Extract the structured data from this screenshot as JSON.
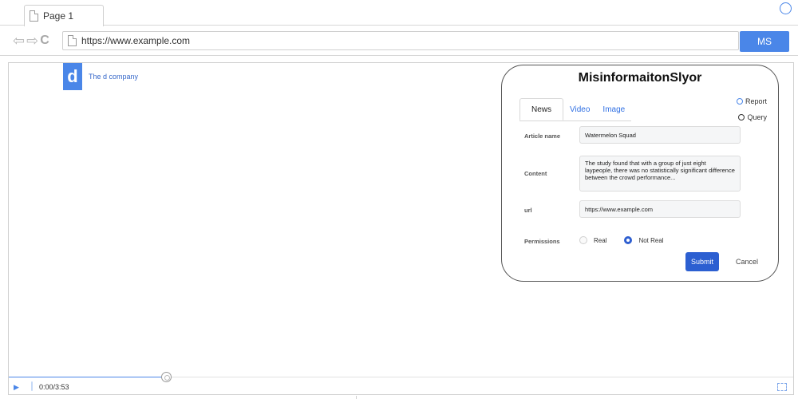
{
  "browser": {
    "tab_title": "Page 1",
    "url": "https://www.example.com",
    "extension_button_label": "MS"
  },
  "site": {
    "logo_letter": "d",
    "company_name": "The d company"
  },
  "popup": {
    "title": "MisinformaitonSlyor",
    "modes": [
      {
        "label": "Report",
        "selected": true
      },
      {
        "label": "Query",
        "selected": false
      }
    ],
    "tabs": [
      {
        "label": "News",
        "active": true
      },
      {
        "label": "Video",
        "active": false
      },
      {
        "label": "Image",
        "active": false
      }
    ],
    "fields": {
      "article_name": {
        "label": "Article name",
        "value": "Watermelon Squad"
      },
      "content": {
        "label": "Content",
        "value": "The study found that with a group of just eight laypeople, there was no statistically significant difference between the crowd performance..."
      },
      "url": {
        "label": "url",
        "value": "https://www.example.com"
      }
    },
    "permissions": {
      "label": "Permissions",
      "options": [
        {
          "label": "Real",
          "selected": false
        },
        {
          "label": "Not Real",
          "selected": true
        }
      ]
    },
    "submit_label": "Submit",
    "cancel_label": "Cancel"
  },
  "media": {
    "time": "0:00/3:53",
    "progress_fraction": 0.2
  },
  "colors": {
    "accent": "#4a86e8",
    "submit": "#2c5fd1"
  }
}
